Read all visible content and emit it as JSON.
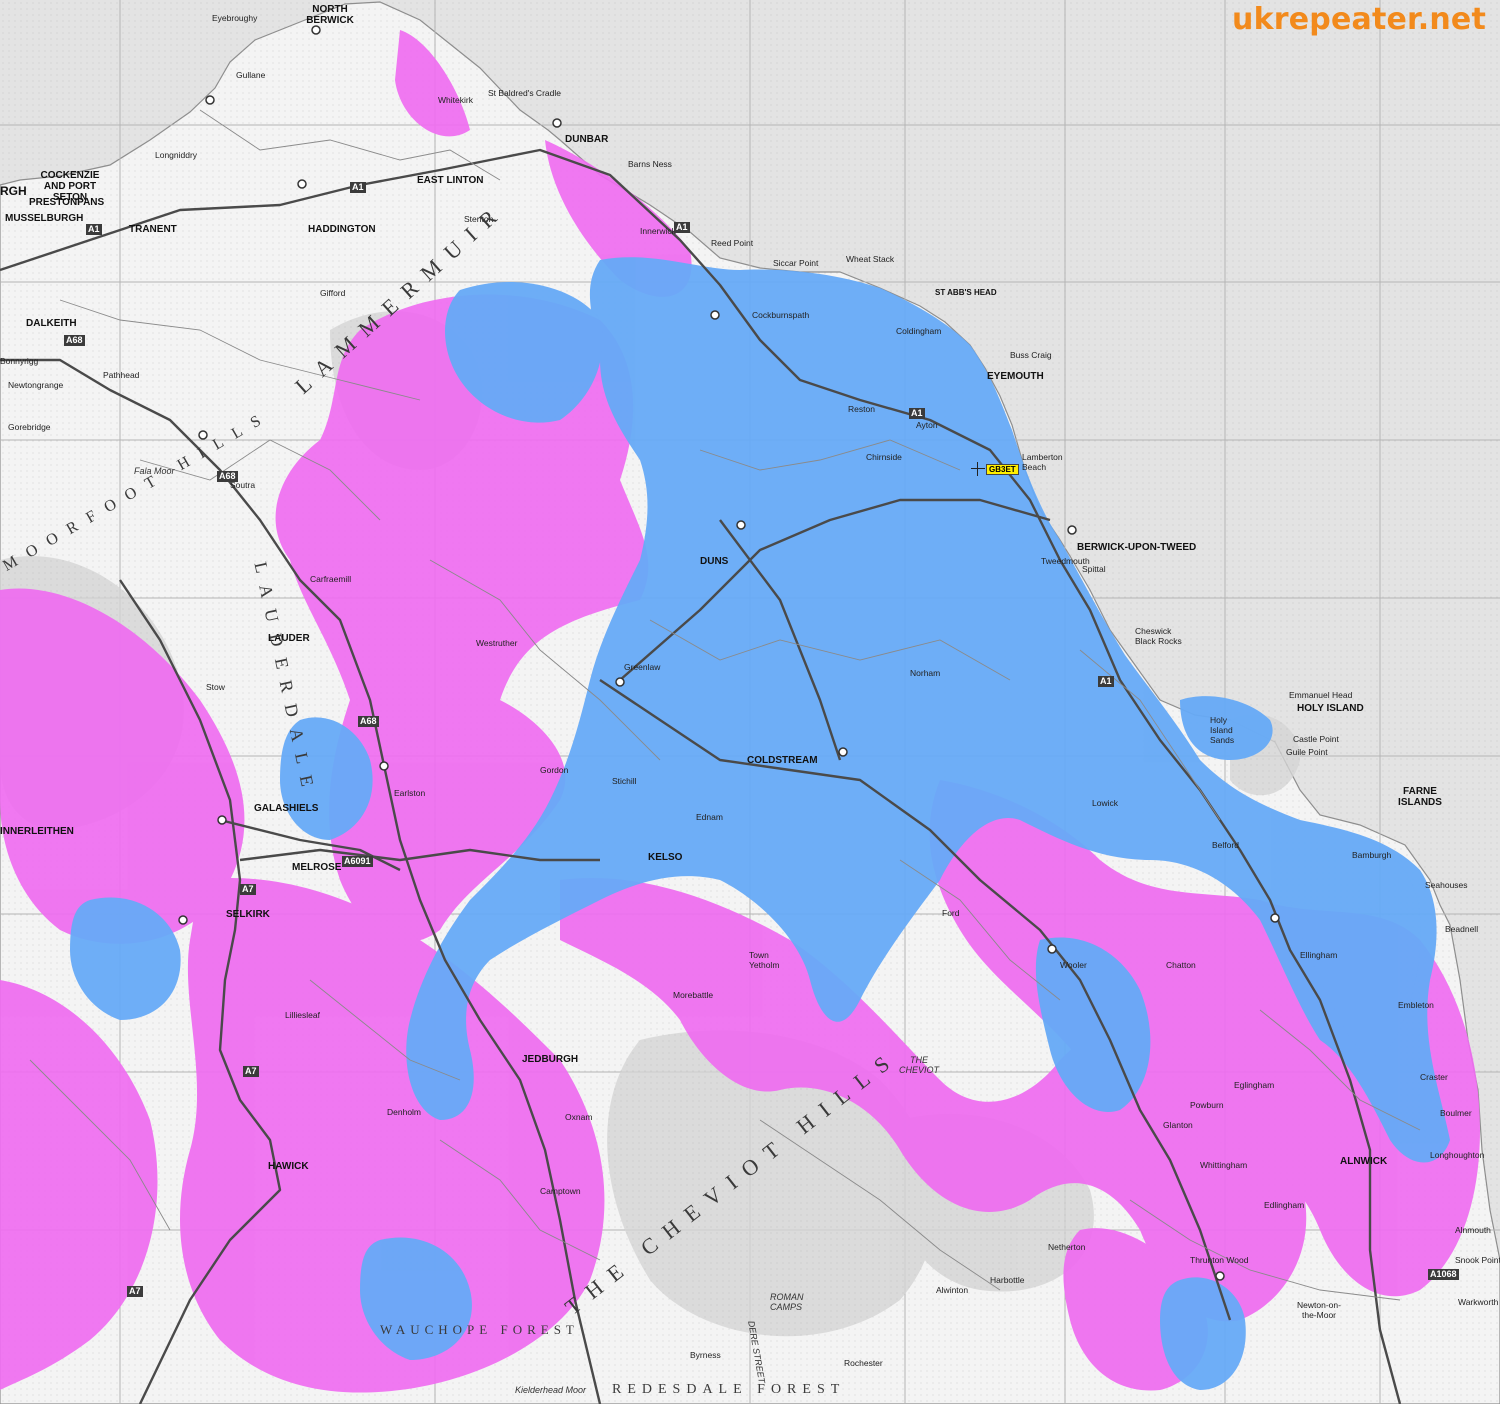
{
  "brand": "ukrepeater.net",
  "repeater_callsign": "GB3ET",
  "colors": {
    "sea": "#e3e3e3",
    "land": "#f3f3f3",
    "coverage_strong": "#66aaf7",
    "coverage_weak": "#ef6cf0",
    "brand": "#f28a1c",
    "road": "#4a4a4a",
    "grid": "#b4b4b4"
  },
  "towns": {
    "north_berwick": "NORTH BERWICK",
    "dunbar": "DUNBAR",
    "cockenzie": "COCKENZIE AND PORT SETON",
    "prestonpans": "PRESTONPANS",
    "musselburgh": "MUSSELBURGH",
    "tranent": "TRANENT",
    "haddington": "HADDINGTON",
    "east_linton": "EAST LINTON",
    "dalkeith": "DALKEITH",
    "eyemouth": "EYEMOUTH",
    "berwick": "BERWICK-UPON-TWEED",
    "coldstream": "COLDSTREAM",
    "kelso": "KELSO",
    "lauder": "LAUDER",
    "galashiels": "GALASHIELS",
    "melrose": "MELROSE",
    "selkirk": "SELKIRK",
    "jedburgh": "JEDBURGH",
    "hawick": "HAWICK",
    "alnwick": "ALNWICK",
    "innerleithen": "INNERLEITHEN",
    "holy_island": "HOLY ISLAND",
    "farne": "FARNE ISLANDS",
    "duns": "DUNS",
    "st_abbs_head": "ST ABB'S HEAD",
    "edinburgh_part": "RGH"
  },
  "places": {
    "gullane": "Gullane",
    "whitekirk": "Whitekirk",
    "st_baldreds": "St Baldred's Cradle",
    "eyebroughy": "Eyebroughy",
    "barns_ness": "Barns Ness",
    "reed_point": "Reed Point",
    "siccar": "Siccar Point",
    "wheat_stack": "Wheat Stack",
    "buss_craig": "Buss Craig",
    "lamberton": "Lamberton Beach",
    "spittal": "Spittal",
    "tweedmouth": "Tweedmouth",
    "cheswick": "Cheswick Black Rocks",
    "emmanuel": "Emmanuel Head",
    "holy_sands": "Holy Island Sands",
    "castle_point": "Castle Point",
    "guile_point": "Guile Point",
    "beadnell": "Beadnell",
    "seahouses": "Seahouses",
    "alnmouth": "Alnmouth",
    "warkworth": "Warkworth",
    "boulmer": "Boulmer",
    "wooler": "Wooler",
    "earlston": "Earlston",
    "greenlaw": "Greenlaw",
    "gordon": "Gordon",
    "chirnside": "Chirnside",
    "longniddry": "Longniddry",
    "gifford": "Gifford",
    "pathhead": "Pathhead",
    "gorebridge": "Gorebridge",
    "newtongrange": "Newtongrange",
    "stow": "Stow",
    "lilliesleaf": "Lilliesleaf",
    "denholm": "Denholm",
    "newcastleton_forest": "Wauchope Forest",
    "ford": "Ford",
    "norham": "Norham",
    "belford": "Belford",
    "bamburgh": "Bamburgh",
    "lowick": "Lowick",
    "ayton": "Ayton",
    "reston": "Reston",
    "coldingham": "Coldingham",
    "cockburnspath": "Cockburnspath",
    "innerwick": "Innerwick",
    "stenton": "Stenton",
    "soutra": "Soutra",
    "carfraemill": "Carfraemill",
    "westruther": "Westruther",
    "stichill": "Stichill",
    "ednam": "Ednam",
    "yetholm": "Town Yetholm",
    "morebattle": "Morebattle",
    "oxnam": "Oxnam",
    "camptown": "Camptown",
    "chatton": "Chatton",
    "eglingham": "Eglingham",
    "whittingham": "Whittingham",
    "glanton": "Glanton",
    "powburn": "Powburn",
    "netherton": "Netherton",
    "alwinton": "Alwinton",
    "harbottle": "Harbottle",
    "byrness": "Byrness",
    "rochester": "Rochester",
    "kielder_moor": "Kielderhead Moor",
    "thrunton": "Thrunton Wood",
    "edlingham": "Edlingham",
    "ellingham": "Ellingham",
    "embleton": "Embleton",
    "craster": "Craster",
    "longhoughton": "Longhoughton",
    "snook_point": "Snook Point",
    "newton_moor": "Newton-on-the-Moor",
    "fala_moor": "Fala Moor",
    "bonnyrigg": "Bonnyrigg"
  },
  "features": {
    "lammermuir": "LAMMERMUIR",
    "lauderdale": "LAUDERDALE",
    "cheviot_hills": "THE CHEVIOT HILLS",
    "the_cheviot": "THE CHEVIOT",
    "moorfoot": "MOORFOOT HILLS",
    "redesdale": "REDESDALE FOREST",
    "wauchope": "WAUCHOPE FOREST",
    "roman_camps": "ROMAN CAMPS",
    "dere_street": "DERE STREET"
  },
  "roads": {
    "a1_n": "A1",
    "a1_mid": "A1",
    "a1_coast": "A1",
    "a1_s": "A1",
    "a68_n": "A68",
    "a68_mid": "A68",
    "a68_s": "A68",
    "a7_n": "A7",
    "a7_s": "A7",
    "a7_sw": "A7",
    "a6091": "A6091",
    "a1068": "A1068",
    "a1_west": "A1"
  }
}
